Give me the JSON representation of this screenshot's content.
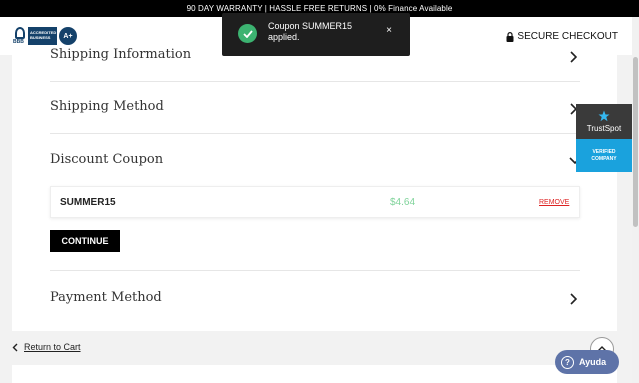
{
  "banner": {
    "text": "90 DAY WARRANTY | HASSLE FREE RETURNS | 0% Finance Available"
  },
  "header": {
    "bbb_short": "BBB",
    "bbb_text": "ACCREDITED BUSINESS",
    "bbb_grade": "A+",
    "secure_label": "SECURE CHECKOUT"
  },
  "toast": {
    "message": "Coupon SUMMER15 applied.",
    "close_label": "×"
  },
  "sections": {
    "shipping_info": "Shipping Information",
    "shipping_method": "Shipping Method",
    "discount_coupon": "Discount Coupon",
    "payment_method": "Payment Method"
  },
  "coupon": {
    "code": "SUMMER15",
    "amount": "$4.64",
    "remove_label": "REMOVE"
  },
  "continue_label": "CONTINUE",
  "return_label": "Return to Cart",
  "trustspot": {
    "name": "TrustSpot",
    "line1": "VERIFIED",
    "line2": "COMPANY"
  },
  "help": {
    "label": "Ayuda",
    "icon_glyph": "?"
  },
  "colors": {
    "accent": "#000000",
    "success": "#3cb371",
    "coupon_amount": "#7fd39a",
    "remove": "#dd2222",
    "trustspot": "#1aa2dd",
    "help": "#5e73a8"
  }
}
